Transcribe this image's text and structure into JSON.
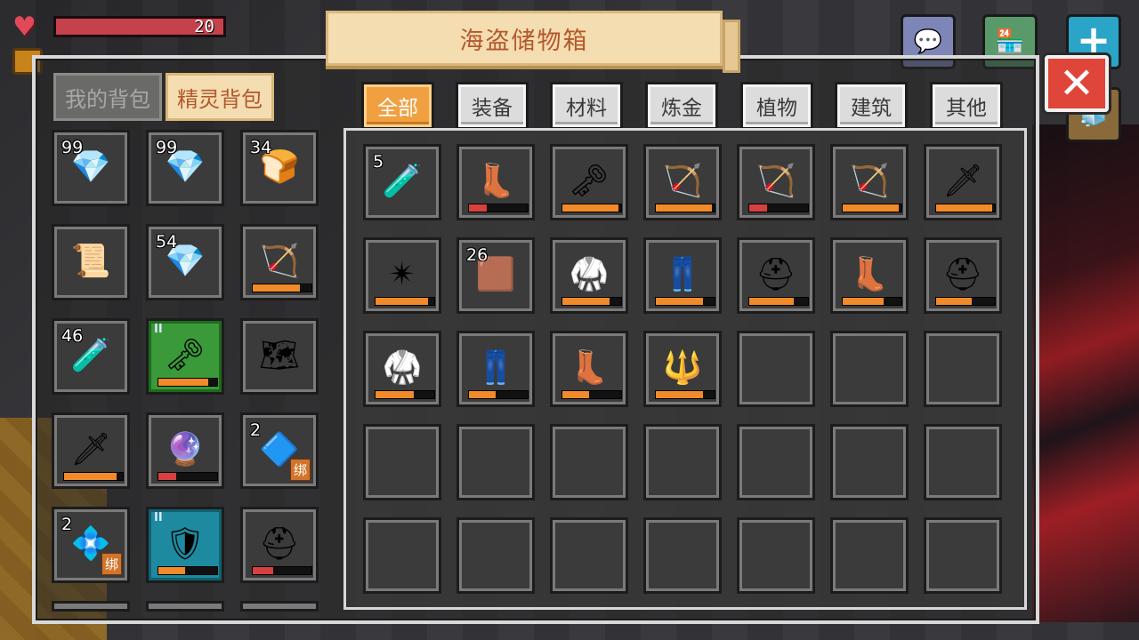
{
  "hud": {
    "health_value": "20",
    "health_fraction": 1.0,
    "icons": {
      "heart": "heart-icon",
      "hunger": "hunger-icon",
      "chat": "chat-icon",
      "shop": "shop-icon",
      "add": "plus-icon",
      "cube": "cube-icon"
    }
  },
  "header": {
    "title": "海盗储物箱",
    "close_label": "✕"
  },
  "bag_tabs": [
    {
      "label": "我的背包",
      "active": false
    },
    {
      "label": "精灵背包",
      "active": true
    }
  ],
  "category_tabs": [
    {
      "label": "全部",
      "active": true
    },
    {
      "label": "装备",
      "active": false
    },
    {
      "label": "材料",
      "active": false
    },
    {
      "label": "炼金",
      "active": false
    },
    {
      "label": "植物",
      "active": false
    },
    {
      "label": "建筑",
      "active": false
    },
    {
      "label": "其他",
      "active": false
    }
  ],
  "colors": {
    "accent": "#f0a040",
    "title_text": "#b4582e",
    "close": "#e0453a",
    "durability_orange": "#f08a2a",
    "durability_red": "#d84040"
  },
  "spirit_bag": [
    {
      "count": "99",
      "icon": "pink-gem-icon",
      "glyph": "💎",
      "style": ""
    },
    {
      "count": "99",
      "icon": "pink-gem-icon",
      "glyph": "💎",
      "style": ""
    },
    {
      "count": "34",
      "icon": "hay-bale-icon",
      "glyph": "🍞",
      "style": ""
    },
    {
      "count": "",
      "icon": "golden-scroll-icon",
      "glyph": "📜",
      "style": ""
    },
    {
      "count": "54",
      "icon": "pink-gem-icon",
      "glyph": "💎",
      "style": ""
    },
    {
      "count": "",
      "icon": "dark-bow-icon",
      "glyph": "🏹",
      "style": "",
      "durability": 0.8,
      "dura_color": "#f08a2a"
    },
    {
      "count": "46",
      "icon": "red-potion-icon",
      "glyph": "🧪",
      "style": ""
    },
    {
      "count": "",
      "icon": "golden-key-staff-icon",
      "glyph": "🗝",
      "style": "green",
      "tier": "II",
      "durability": 0.85,
      "dura_color": "#f08a2a"
    },
    {
      "count": "",
      "icon": "treasure-map-icon",
      "glyph": "🗺",
      "style": ""
    },
    {
      "count": "",
      "icon": "crimson-sword-icon",
      "glyph": "🗡",
      "style": "",
      "durability": 0.9,
      "dura_color": "#f08a2a"
    },
    {
      "count": "",
      "icon": "purple-crystal-staff-icon",
      "glyph": "🔮",
      "style": "",
      "durability": 0.3,
      "dura_color": "#d84040"
    },
    {
      "count": "2",
      "icon": "blue-gem-icon",
      "glyph": "🔷",
      "style": "",
      "bind": "绑"
    },
    {
      "count": "2",
      "icon": "cyan-gem-icon",
      "glyph": "💠",
      "style": "",
      "bind": "绑"
    },
    {
      "count": "",
      "icon": "shield-emblem-icon",
      "glyph": "🛡",
      "style": "teal",
      "tier": "II",
      "durability": 0.45,
      "dura_color": "#f08a2a"
    },
    {
      "count": "",
      "icon": "golden-helmet-icon",
      "glyph": "⛑",
      "style": "",
      "durability": 0.35,
      "dura_color": "#d84040"
    }
  ],
  "chest": [
    {
      "count": "5",
      "icon": "magenta-potion-icon",
      "glyph": "🧪"
    },
    {
      "count": "",
      "icon": "golden-boots-icon",
      "glyph": "👢",
      "durability": 0.3,
      "dura_color": "#d84040"
    },
    {
      "count": "",
      "icon": "golden-key-staff-icon",
      "glyph": "🗝",
      "durability": 0.95,
      "dura_color": "#f08a2a"
    },
    {
      "count": "",
      "icon": "purple-quiver-icon",
      "glyph": "🏹",
      "durability": 0.95,
      "dura_color": "#f08a2a"
    },
    {
      "count": "",
      "icon": "red-quiver-icon",
      "glyph": "🏹",
      "durability": 0.3,
      "dura_color": "#d84040"
    },
    {
      "count": "",
      "icon": "flame-bow-icon",
      "glyph": "🏹",
      "durability": 0.95,
      "dura_color": "#f08a2a"
    },
    {
      "count": "",
      "icon": "crimson-sword-icon",
      "glyph": "🗡",
      "durability": 0.95,
      "dura_color": "#f08a2a"
    },
    {
      "count": "",
      "icon": "golden-rune-icon",
      "glyph": "✴",
      "durability": 0.9,
      "dura_color": "#f08a2a"
    },
    {
      "count": "26",
      "icon": "dirt-block-icon",
      "glyph": "🟫"
    },
    {
      "count": "",
      "icon": "golden-armor-icon",
      "glyph": "🥋",
      "durability": 0.8,
      "dura_color": "#f08a2a"
    },
    {
      "count": "",
      "icon": "blue-leggings-icon",
      "glyph": "👖",
      "durability": 0.8,
      "dura_color": "#f08a2a"
    },
    {
      "count": "",
      "icon": "golden-helmet-icon",
      "glyph": "⛑",
      "durability": 0.75,
      "dura_color": "#f08a2a"
    },
    {
      "count": "",
      "icon": "golden-boots-icon",
      "glyph": "👢",
      "durability": 0.7,
      "dura_color": "#f08a2a"
    },
    {
      "count": "",
      "icon": "red-helmet-icon",
      "glyph": "⛑",
      "durability": 0.6,
      "dura_color": "#f08a2a"
    },
    {
      "count": "",
      "icon": "red-chestplate-icon",
      "glyph": "🥋",
      "durability": 0.65,
      "dura_color": "#f08a2a"
    },
    {
      "count": "",
      "icon": "red-leggings-icon",
      "glyph": "👖",
      "durability": 0.45,
      "dura_color": "#f08a2a"
    },
    {
      "count": "",
      "icon": "red-boots-icon",
      "glyph": "👢",
      "durability": 0.45,
      "dura_color": "#f08a2a"
    },
    {
      "count": "",
      "icon": "ice-trident-icon",
      "glyph": "🔱",
      "durability": 0.8,
      "dura_color": "#f08a2a"
    },
    {},
    {},
    {},
    {},
    {},
    {},
    {},
    {},
    {},
    {},
    {},
    {},
    {},
    {},
    {},
    {},
    {}
  ]
}
